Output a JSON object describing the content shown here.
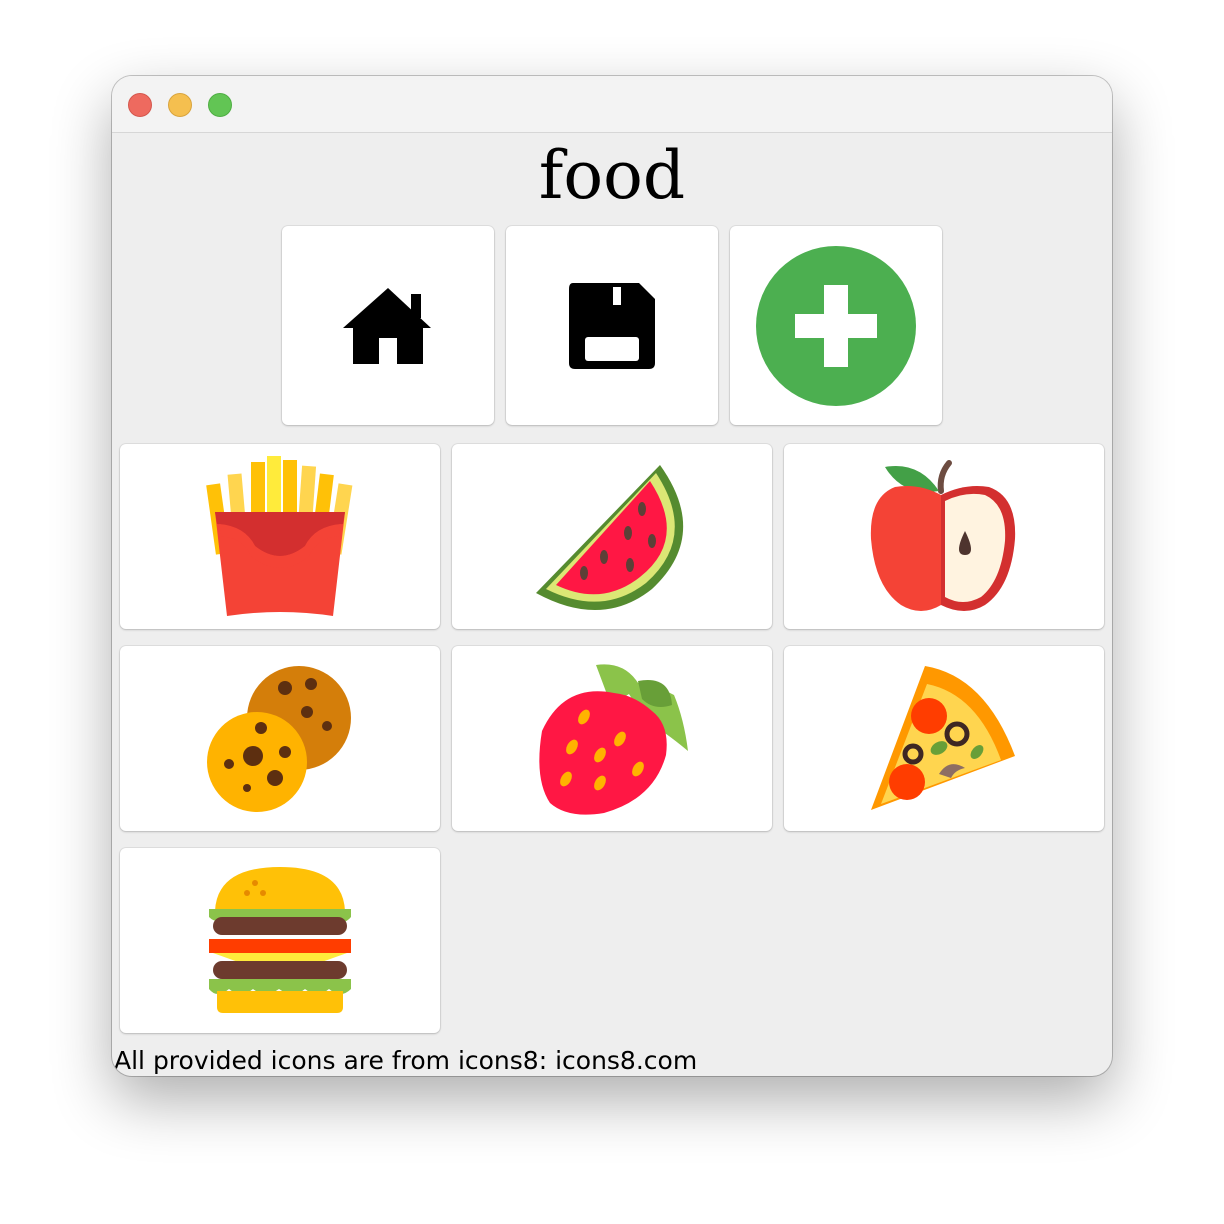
{
  "window": {
    "title": "food"
  },
  "toolbar": [
    {
      "name": "home-button",
      "icon": "home-icon"
    },
    {
      "name": "save-button",
      "icon": "floppy-disk-icon"
    },
    {
      "name": "add-button",
      "icon": "plus-circle-icon",
      "color": "#4caf50"
    }
  ],
  "items": [
    {
      "name": "french-fries",
      "icon": "french-fries-icon"
    },
    {
      "name": "watermelon",
      "icon": "watermelon-icon"
    },
    {
      "name": "apple",
      "icon": "apple-icon"
    },
    {
      "name": "cookies",
      "icon": "cookies-icon"
    },
    {
      "name": "strawberry",
      "icon": "strawberry-icon"
    },
    {
      "name": "pizza",
      "icon": "pizza-icon"
    },
    {
      "name": "hamburger",
      "icon": "hamburger-icon"
    }
  ],
  "footer": {
    "text": "All provided icons are from icons8: icons8.com"
  }
}
